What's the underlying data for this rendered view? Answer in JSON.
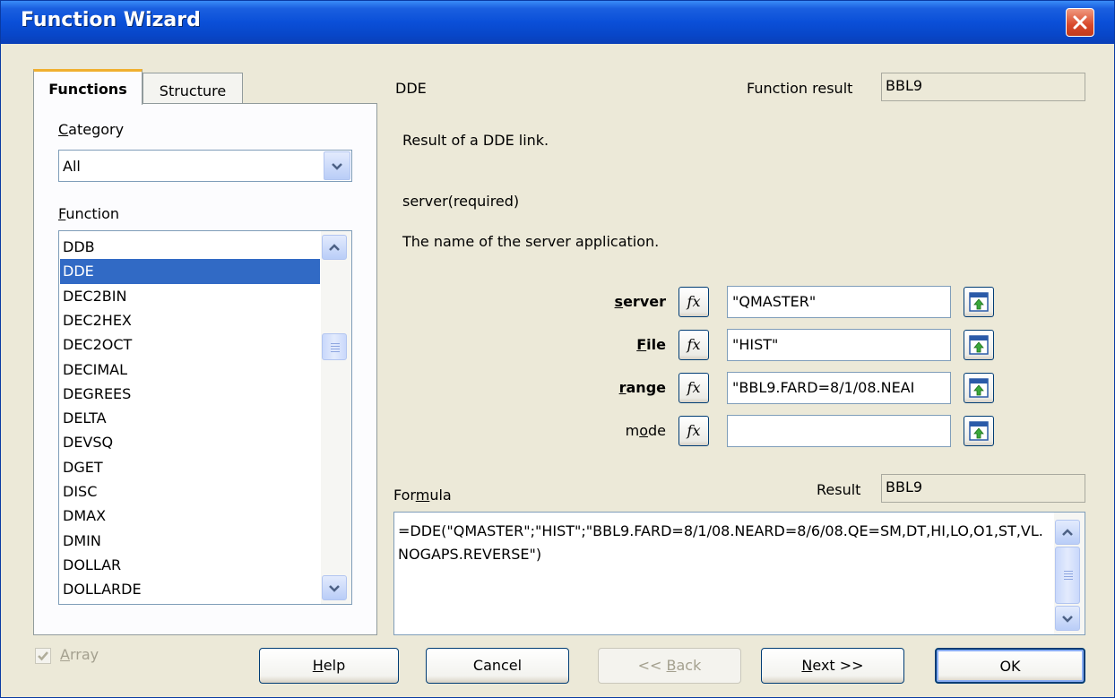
{
  "window": {
    "title": "Function Wizard"
  },
  "tabs": {
    "functions": "Functions",
    "structure": "Structure"
  },
  "category": {
    "label": "Category",
    "mnemonic": "C",
    "rest": "ategory",
    "value": "All"
  },
  "function_list": {
    "label_mnemonic": "F",
    "label_rest": "unction",
    "items": [
      "DDB",
      "DDE",
      "DEC2BIN",
      "DEC2HEX",
      "DEC2OCT",
      "DECIMAL",
      "DEGREES",
      "DELTA",
      "DEVSQ",
      "DGET",
      "DISC",
      "DMAX",
      "DMIN",
      "DOLLAR",
      "DOLLARDE"
    ],
    "selected": "DDE"
  },
  "function_info": {
    "name": "DDE",
    "result_label": "Function result",
    "result_value": "BBL9",
    "description": "Result of a DDE link.",
    "param_title": "server(required)",
    "param_description": "The name of the server application."
  },
  "arguments": [
    {
      "pre": "",
      "mn": "s",
      "post": "erver",
      "bold": true,
      "value": "\"QMASTER\""
    },
    {
      "pre": "",
      "mn": "F",
      "post": "ile",
      "bold": true,
      "value": "\"HIST\""
    },
    {
      "pre": "",
      "mn": "r",
      "post": "ange",
      "bold": true,
      "value": "\"BBL9.FARD=8/1/08.NEAI"
    },
    {
      "pre": "m",
      "mn": "o",
      "post": "de",
      "bold": false,
      "value": ""
    }
  ],
  "fx_label": "fx",
  "formula": {
    "label_pre": "For",
    "label_mn": "m",
    "label_post": "ula",
    "result_label": "Result",
    "result_value": "BBL9",
    "text": "=DDE(\"QMASTER\";\"HIST\";\"BBL9.FARD=8/1/08.NEARD=8/6/08.QE=SM,DT,HI,LO,O1,ST,VL.NOGAPS.REVERSE\")"
  },
  "array_checkbox": {
    "mn": "A",
    "rest": "rray",
    "checked": true
  },
  "buttons": {
    "help": {
      "mn": "H",
      "rest": "elp"
    },
    "cancel": "Cancel",
    "back": {
      "pre": "<< ",
      "mn": "B",
      "rest": "ack"
    },
    "next": {
      "mn": "N",
      "rest": "ext >>"
    },
    "ok": "OK"
  },
  "colors": {
    "titlebar": "#0a4fd8",
    "selection": "#316ac5",
    "dialog_bg": "#ece9d8"
  }
}
